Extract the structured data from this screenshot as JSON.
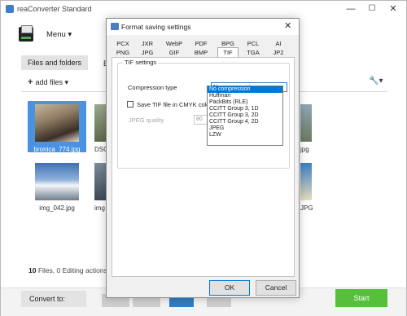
{
  "window": {
    "title": "reaConverter Standard",
    "minimize": "—",
    "maximize": "☐",
    "close": "✕"
  },
  "menu": {
    "label": "Menu ▾"
  },
  "tabs": {
    "files_and_folders": "Files and folders",
    "partial": "E"
  },
  "toolbar": {
    "add_files": "add files ▾",
    "tools": "🔧▾"
  },
  "files": [
    {
      "name": "bronica_774.jpg",
      "selected": true
    },
    {
      "name": "DSC",
      "selected": false
    },
    {
      "name": "img_042.jpg",
      "selected": false
    },
    {
      "name": "img",
      "selected": false
    },
    {
      "name": "jpg",
      "selected": false
    },
    {
      "name": "JPG",
      "selected": false
    }
  ],
  "status": {
    "count": "10",
    "files_label": " Files, ",
    "editing": "0",
    "editing_label": " Editing actions,"
  },
  "bottom": {
    "convert_to": "Convert to:",
    "start": "Start"
  },
  "dialog": {
    "title": "Format saving settings",
    "close": "✕",
    "tab_row1": [
      "PCX",
      "JXR",
      "WebP",
      "PDF",
      "BPG",
      "PCL",
      "AI"
    ],
    "tab_row2": [
      "PNG",
      "JPG",
      "GIF",
      "BMP",
      "TIF",
      "TGA",
      "JP2"
    ],
    "active_tab": "TIF",
    "group_label": "TIF settings",
    "compression_label": "Compression type",
    "compression_value": "No compression",
    "cmyk_label": "Save TIF file in CMYK color",
    "jpeg_quality_label": "JPEG quality",
    "jpeg_quality_value": "80",
    "options": [
      "No compression",
      "Huffman",
      "PackBits (RLE)",
      "CCITT Group 3, 1D",
      "CCITT Group 3, 2D",
      "CCITT Group 4, 2D",
      "JPEG",
      "LZW"
    ],
    "highlighted_option": "No compression",
    "ok": "OK",
    "cancel": "Cancel"
  },
  "colors": {
    "accent": "#0078d7",
    "selection": "#3d8de2",
    "start": "#55c13a"
  }
}
